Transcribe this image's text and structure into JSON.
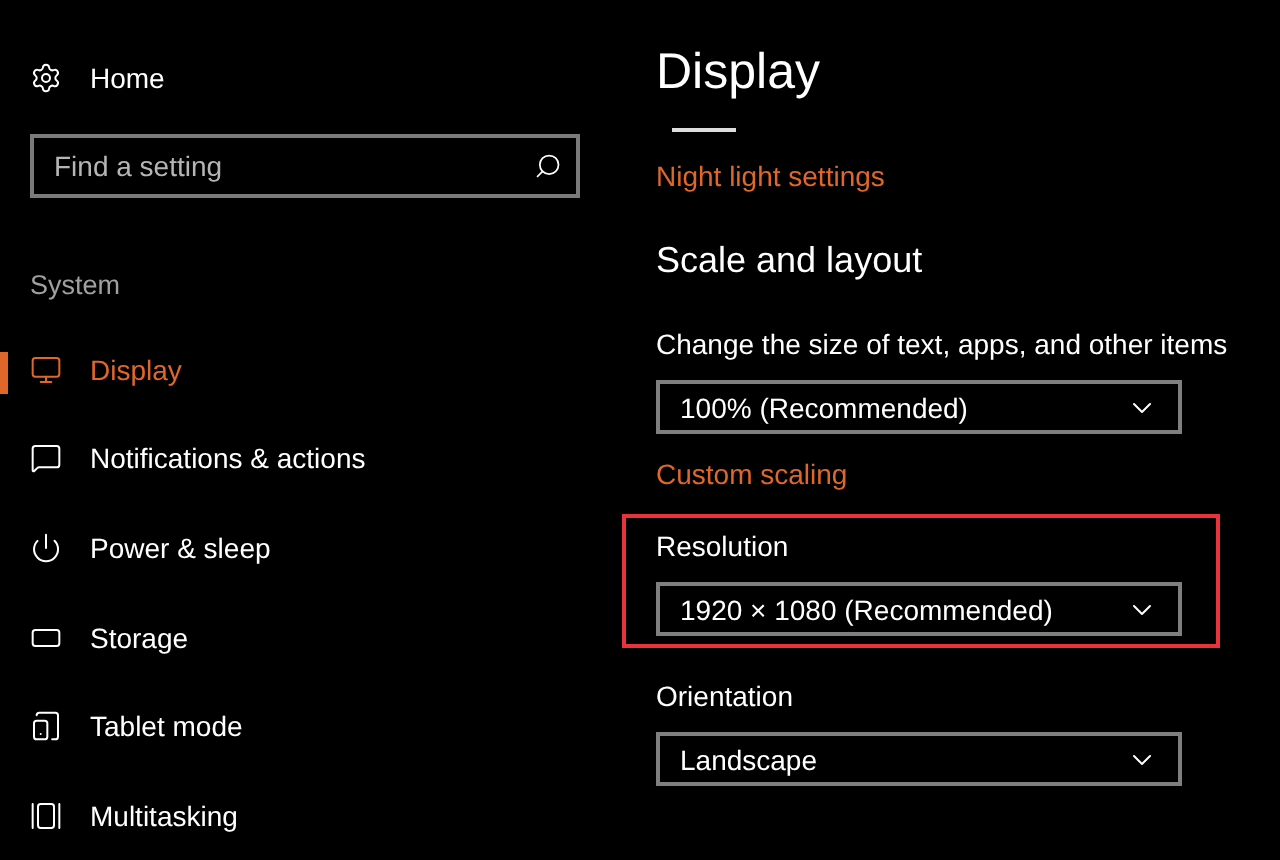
{
  "sidebar": {
    "home": "Home",
    "search": {
      "placeholder": "Find a setting"
    },
    "section": "System",
    "items": [
      {
        "label": "Display",
        "selected": true
      },
      {
        "label": "Notifications & actions",
        "selected": false
      },
      {
        "label": "Power & sleep",
        "selected": false
      },
      {
        "label": "Storage",
        "selected": false
      },
      {
        "label": "Tablet mode",
        "selected": false
      },
      {
        "label": "Multitasking",
        "selected": false
      }
    ]
  },
  "main": {
    "title": "Display",
    "night_light_link": "Night light settings",
    "section_title": "Scale and layout",
    "settings": [
      {
        "kind": "dropdown",
        "label": "Change the size of text, apps, and other items",
        "value": "100% (Recommended)",
        "highlighted": false
      },
      {
        "kind": "link",
        "label": "Custom scaling"
      },
      {
        "kind": "dropdown",
        "label": "Resolution",
        "value": "1920 × 1080 (Recommended)",
        "highlighted": true
      },
      {
        "kind": "dropdown",
        "label": "Orientation",
        "value": "Landscape",
        "highlighted": false
      }
    ]
  }
}
